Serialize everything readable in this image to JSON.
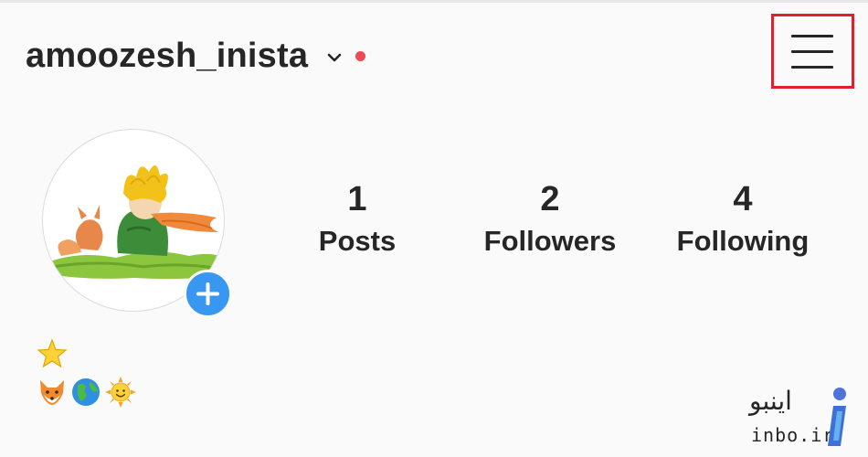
{
  "profile": {
    "username": "amoozesh_inista"
  },
  "stats": [
    {
      "value": "1",
      "label": "Posts"
    },
    {
      "value": "2",
      "label": "Followers"
    },
    {
      "value": "4",
      "label": "Following"
    }
  ],
  "icons": {
    "dropdown": "chevron-down-icon",
    "notification": "notification-dot-icon",
    "menu": "hamburger-menu-icon",
    "add_story": "plus-icon"
  },
  "bio": {
    "line1_icons": [
      "star-emoji"
    ],
    "line2_icons": [
      "fox-emoji",
      "globe-emoji",
      "sun-face-emoji"
    ]
  },
  "watermark": {
    "text_fa": "اینبو",
    "text_en": "inbo.ir"
  },
  "colors": {
    "background": "#fafafa",
    "text": "#262626",
    "notification_dot": "#ed4956",
    "add_button": "#3897f0",
    "highlight_box": "#e0202a",
    "watermark_accent": "#3f6fd8"
  }
}
